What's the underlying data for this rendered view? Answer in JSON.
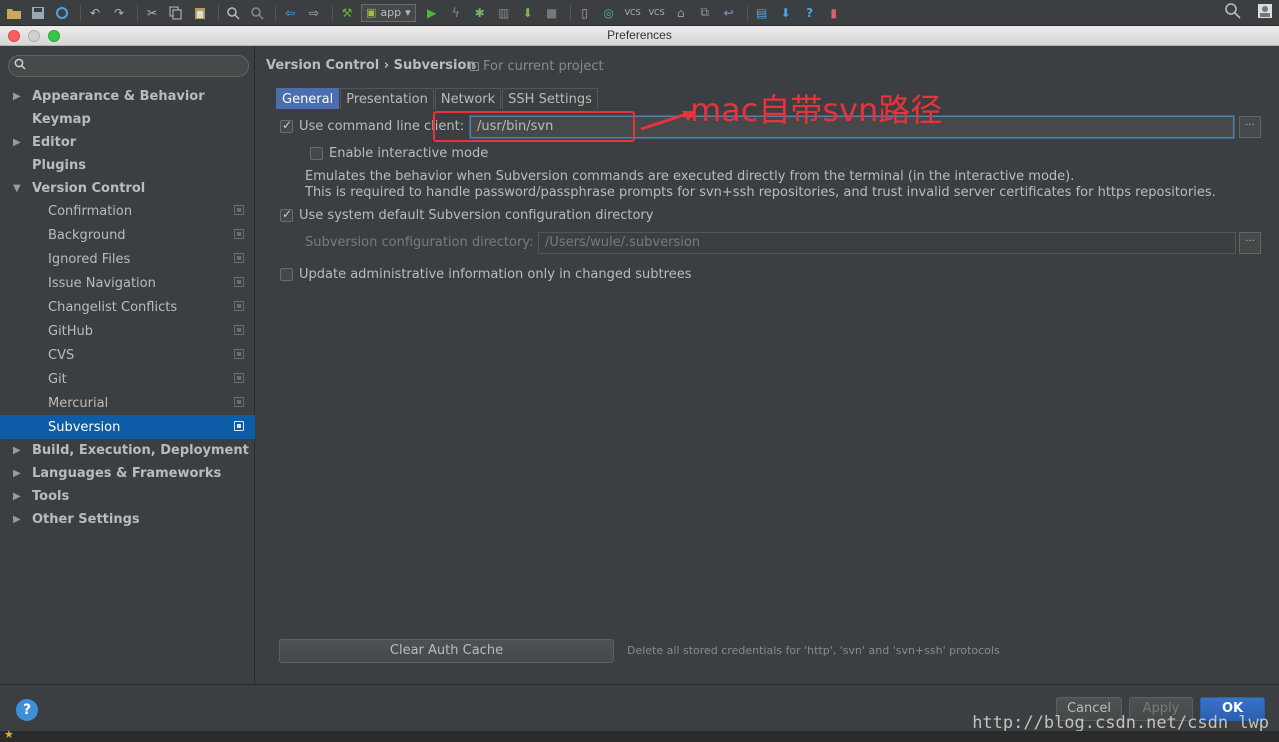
{
  "toolbar": {
    "run_config": "app"
  },
  "window": {
    "title": "Preferences"
  },
  "sidebar": {
    "search_placeholder": "",
    "items": [
      {
        "label": "Appearance & Behavior",
        "expandable": true,
        "bold": true
      },
      {
        "label": "Keymap",
        "expandable": false,
        "bold": true
      },
      {
        "label": "Editor",
        "expandable": true,
        "bold": true
      },
      {
        "label": "Plugins",
        "expandable": false,
        "bold": true
      },
      {
        "label": "Version Control",
        "expandable": true,
        "expanded": true,
        "bold": true
      },
      {
        "label": "Confirmation",
        "child": true
      },
      {
        "label": "Background",
        "child": true
      },
      {
        "label": "Ignored Files",
        "child": true
      },
      {
        "label": "Issue Navigation",
        "child": true
      },
      {
        "label": "Changelist Conflicts",
        "child": true
      },
      {
        "label": "GitHub",
        "child": true
      },
      {
        "label": "CVS",
        "child": true
      },
      {
        "label": "Git",
        "child": true
      },
      {
        "label": "Mercurial",
        "child": true
      },
      {
        "label": "Subversion",
        "child": true,
        "selected": true
      },
      {
        "label": "Build, Execution, Deployment",
        "expandable": true,
        "bold": true
      },
      {
        "label": "Languages & Frameworks",
        "expandable": true,
        "bold": true
      },
      {
        "label": "Tools",
        "expandable": true,
        "bold": true
      },
      {
        "label": "Other Settings",
        "expandable": true,
        "bold": true
      }
    ]
  },
  "main": {
    "breadcrumb": "Version Control › Subversion",
    "for_project": "For current project",
    "tabs": [
      {
        "label": "General",
        "active": true
      },
      {
        "label": "Presentation"
      },
      {
        "label": "Network"
      },
      {
        "label": "SSH Settings"
      }
    ],
    "general": {
      "use_cmd_client_label": "Use command line client:",
      "use_cmd_client_checked": true,
      "cmd_client_path": "/usr/bin/svn",
      "interactive_label": "Enable interactive mode",
      "interactive_checked": false,
      "description_line1": "Emulates the behavior when Subversion commands are executed directly from the terminal (in the interactive mode).",
      "description_line2": "This is required to handle password/passphrase prompts for svn+ssh repositories, and trust invalid server certificates for https repositories.",
      "use_system_config_label": "Use system default Subversion configuration directory",
      "use_system_config_checked": true,
      "config_dir_label": "Subversion configuration directory:",
      "config_dir_value": "/Users/wule/.subversion",
      "update_admin_label": "Update administrative information only in changed subtrees",
      "update_admin_checked": false,
      "clear_auth_button": "Clear Auth Cache",
      "clear_auth_hint": "Delete all stored credentials for 'http', 'svn' and 'svn+ssh' protocols"
    },
    "annotation": "mac自带svn路径"
  },
  "footer": {
    "cancel": "Cancel",
    "apply": "Apply",
    "ok": "OK",
    "watermark": "http://blog.csdn.net/csdn_lwp"
  },
  "colors": {
    "accent": "#0d5ca7",
    "annotation_red": "#e8323c",
    "background": "#3c3f41"
  }
}
